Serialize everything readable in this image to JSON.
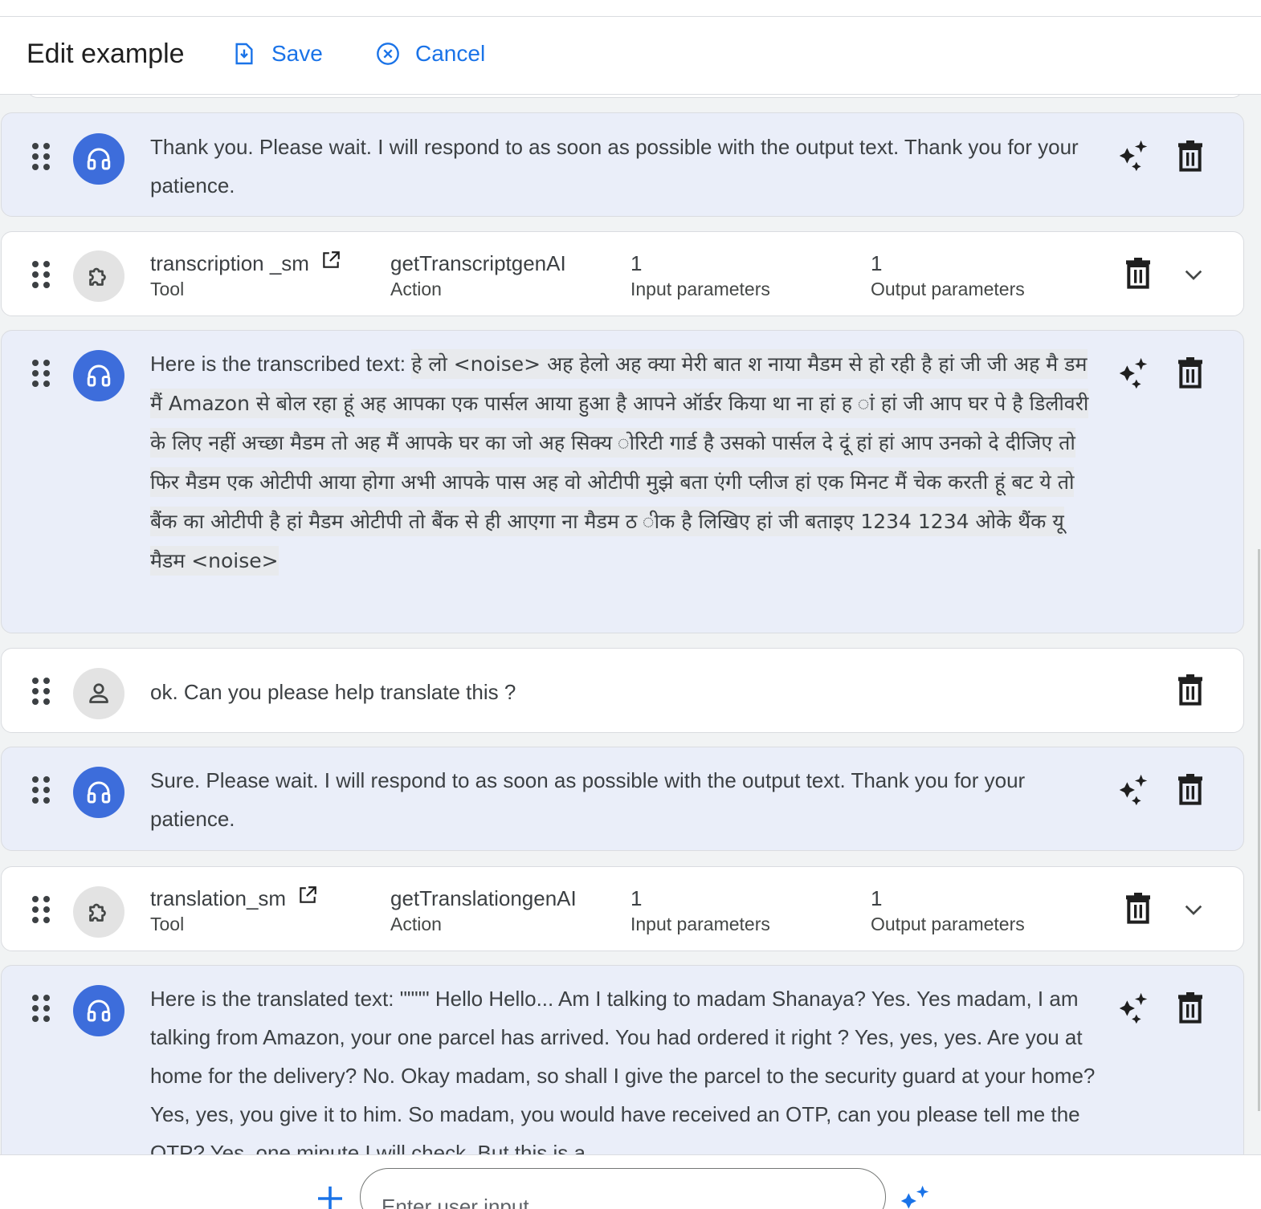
{
  "header": {
    "title": "Edit example",
    "save_label": "Save",
    "cancel_label": "Cancel",
    "accent_color": "#1a73e8"
  },
  "messages": [
    {
      "role": "agent",
      "text": "Thank you. Please wait. I will respond to as soon as possible with the output text. Thank you for your patience."
    },
    {
      "role": "tool",
      "tool": "transcription _sm",
      "tool_label": "Tool",
      "action": "getTranscriptgenAI",
      "action_label": "Action",
      "inputs": "1",
      "inputs_label": "Input parameters",
      "outputs": "1",
      "outputs_label": "Output parameters"
    },
    {
      "role": "agent",
      "prefix": "Here is the transcribed text: ",
      "text": "हे लो <noise> अह हेलो अह क्या मेरी बात श नाया मैडम से हो रही है हां जी जी अह मै डम मैं Amazon से बोल रहा हूं अह आपका एक पार्सल आया हुआ है आपने ऑर्डर किया था ना हां ह ां हां जी आप घर पे है डिलीवरी के लिए नहीं अच्छा मैडम तो अह मैं आपके घर का जो अह सिक्य ोरिटी गार्ड है उसको पार्सल दे दूं हां हां आप उनको दे दीजिए तो फिर मैडम एक ओटीपी आया होगा अभी आपके पास अह वो ओटीपी मुझे बता एंगी प्लीज हां एक मिनट मैं चेक करती हूं बट ये तो बैंक का ओटीपी है हां मैडम ओटीपी तो बैंक से ही आएगा ना मैडम ठ ीक है लिखिए हां जी बताइए 1234 1234 ओके थैंक यू मैडम <noise>"
    },
    {
      "role": "user",
      "text": "ok. Can you please help translate this ?"
    },
    {
      "role": "agent",
      "text": "Sure. Please wait. I will respond to as soon as possible with the output text. Thank you for your patience."
    },
    {
      "role": "tool",
      "tool": "translation_sm",
      "tool_label": "Tool",
      "action": "getTranslationgenAI",
      "action_label": "Action",
      "inputs": "1",
      "inputs_label": "Input parameters",
      "outputs": "1",
      "outputs_label": "Output parameters"
    },
    {
      "role": "agent",
      "text": "Here is the translated text: \"\"\"\" Hello Hello... Am I talking to madam Shanaya? Yes. Yes madam, I am talking from Amazon, your one parcel has arrived. You had ordered it right ? Yes, yes, yes. Are you at home for the delivery? No. Okay madam, so shall I give the parcel to the security guard at your home? Yes, yes, you give it to him. So madam, you would have received an OTP, can you please tell me the OTP? Yes, one minute I will check. But this is a"
    }
  ],
  "composer": {
    "placeholder": "Enter user input"
  },
  "colors": {
    "agent_card_bg": "#eaeef9",
    "agent_avatar": "#3d6ddb",
    "page_bg": "#f1f3f4"
  },
  "icons": [
    "save-icon",
    "cancel-icon",
    "drag-handle-icon",
    "headset-icon",
    "puzzle-icon",
    "person-icon",
    "sparkle-icon",
    "trash-icon",
    "chevron-down-icon",
    "external-link-icon",
    "plus-icon"
  ]
}
